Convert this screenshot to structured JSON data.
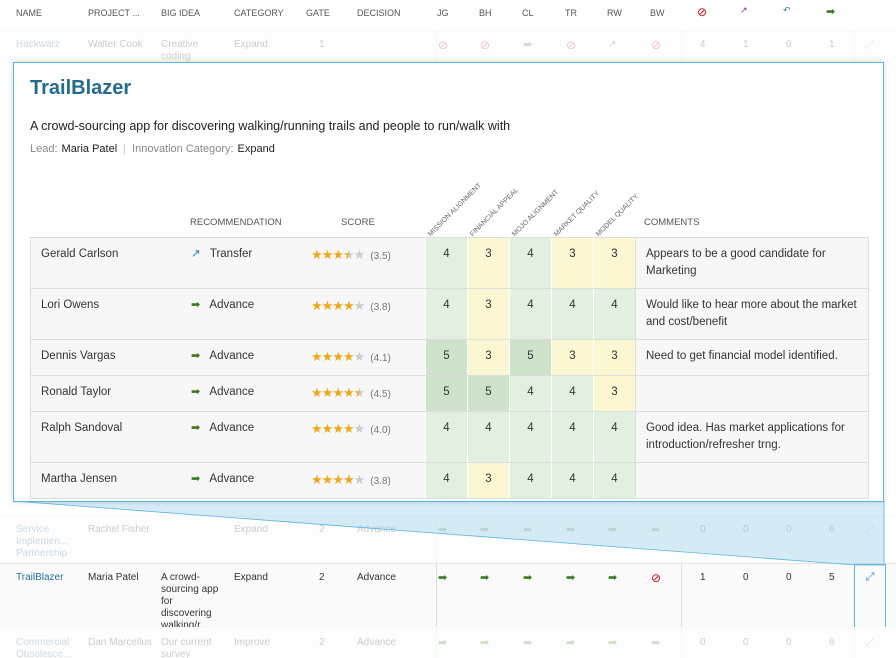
{
  "header": {
    "columns": [
      "NAME",
      "PROJECT ...",
      "BIG IDEA",
      "CATEGORY",
      "GATE",
      "DECISION",
      "JG",
      "BH",
      "CL",
      "TR",
      "RW",
      "BW"
    ],
    "summary_icons": [
      "stop-icon",
      "transfer-icon",
      "back-icon",
      "advance-icon"
    ]
  },
  "rows": [
    {
      "name": "Hackwarz",
      "lead": "Walter Cook",
      "idea": "Creative coding",
      "category": "Expand",
      "gate": "1",
      "decision": "",
      "votes": [
        "stop",
        "stop",
        "go",
        "stop",
        "xfer",
        "stop"
      ],
      "counts": [
        "4",
        "1",
        "0",
        "1"
      ]
    },
    {
      "name": "Service Implemen... Partnership",
      "lead": "Rachel Fisher",
      "idea": "",
      "category": "Expand",
      "gate": "2",
      "decision": "Advance",
      "votes": [
        "go",
        "go",
        "go",
        "go",
        "go",
        "go"
      ],
      "counts": [
        "0",
        "0",
        "0",
        "6"
      ]
    },
    {
      "name": "TrailBlazer",
      "lead": "Maria Patel",
      "idea": "A crowd-sourcing app for discovering walking/r...",
      "category": "Expand",
      "gate": "2",
      "decision": "Advance",
      "votes": [
        "go",
        "go",
        "go",
        "go",
        "go",
        "stop"
      ],
      "counts": [
        "1",
        "0",
        "0",
        "5"
      ]
    },
    {
      "name": "Commercial Obsolesce...",
      "lead": "Dan Marcellus",
      "idea": "Our current survey",
      "category": "Improve",
      "gate": "2",
      "decision": "Advance",
      "votes": [
        "go",
        "go",
        "go",
        "go",
        "go",
        "go"
      ],
      "counts": [
        "0",
        "0",
        "0",
        "6"
      ]
    }
  ],
  "detail": {
    "title": "TrailBlazer",
    "description": "A crowd-sourcing app for discovering walking/running trails and people to run/walk with",
    "lead_label": "Lead:",
    "lead": "Maria Patel",
    "category_label": "Innovation Category:",
    "category": "Expand",
    "headers": {
      "recommendation": "RECOMMENDATION",
      "score": "SCORE",
      "comments": "COMMENTS",
      "criteria": [
        "MISSION ALIGNMENT",
        "FINANCIAL APPEAL",
        "MOJO ALIGNMENT",
        "MARKET QUALITY",
        "MODEL QUALITY"
      ]
    },
    "reviews": [
      {
        "name": "Gerald Carlson",
        "rec": "Transfer",
        "rec_icon": "transfer-icon",
        "score": 3.5,
        "score_text": "(3.5)",
        "values": [
          4,
          3,
          4,
          3,
          3
        ],
        "comment": "Appears to be a good candidate for Marketing"
      },
      {
        "name": "Lori Owens",
        "rec": "Advance",
        "rec_icon": "advance-icon",
        "score": 3.8,
        "score_text": "(3.8)",
        "values": [
          4,
          3,
          4,
          4,
          4
        ],
        "comment": "Would like to hear more about the market and cost/benefit"
      },
      {
        "name": "Dennis Vargas",
        "rec": "Advance",
        "rec_icon": "advance-icon",
        "score": 4.1,
        "score_text": "(4.1)",
        "values": [
          5,
          3,
          5,
          3,
          3
        ],
        "comment": "Need to get financial model identified."
      },
      {
        "name": "Ronald Taylor",
        "rec": "Advance",
        "rec_icon": "advance-icon",
        "score": 4.5,
        "score_text": "(4.5)",
        "values": [
          5,
          5,
          4,
          4,
          3
        ],
        "comment": ""
      },
      {
        "name": "Ralph Sandoval",
        "rec": "Advance",
        "rec_icon": "advance-icon",
        "score": 4.0,
        "score_text": "(4.0)",
        "values": [
          4,
          4,
          4,
          4,
          4
        ],
        "comment": "Good idea. Has market applications for introduction/refresher trng."
      },
      {
        "name": "Martha Jensen",
        "rec": "Advance",
        "rec_icon": "advance-icon",
        "score": 3.8,
        "score_text": "(3.8)",
        "values": [
          4,
          3,
          4,
          4,
          4
        ],
        "comment": ""
      }
    ]
  }
}
